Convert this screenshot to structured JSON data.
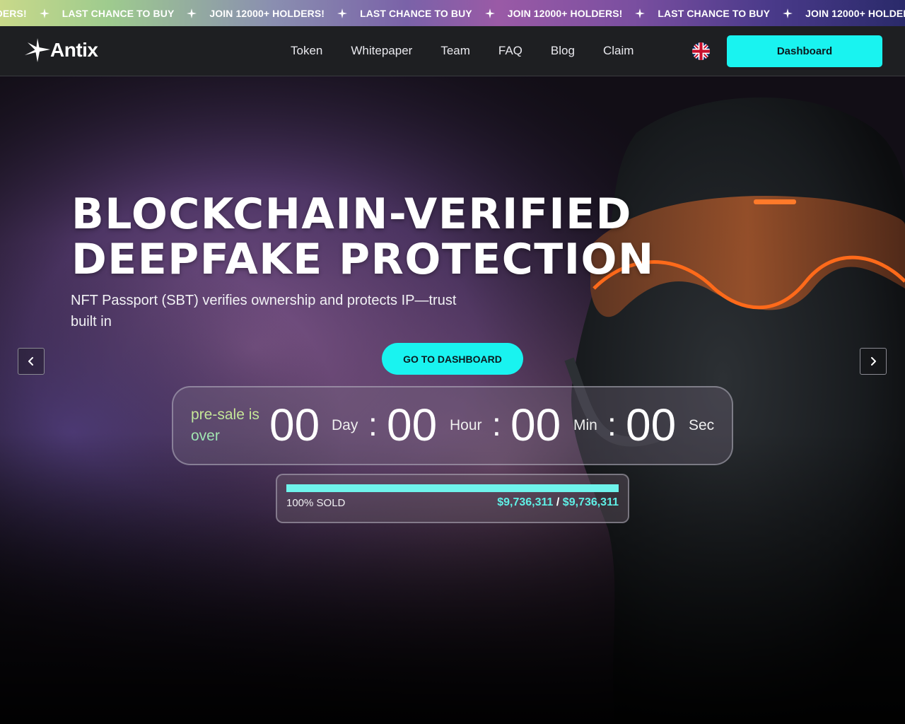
{
  "ticker": {
    "items": [
      "LDERS!",
      "LAST CHANCE TO BUY",
      "JOIN 12000+ HOLDERS!",
      "LAST CHANCE TO BUY",
      "JOIN 12000+ HOLDERS!",
      "LAST CHANCE TO BUY",
      "JOIN 12000+ HOLDERS!"
    ]
  },
  "header": {
    "logo_text": "Antix",
    "nav": [
      "Token",
      "Whitepaper",
      "Team",
      "FAQ",
      "Blog",
      "Claim"
    ],
    "language_icon": "uk-flag-icon",
    "dashboard_label": "Dashboard"
  },
  "hero": {
    "headline_line1": "BLOCKCHAIN-VERIFIED",
    "headline_line2": "DEEPFAKE PROTECTION",
    "subtitle": "NFT Passport (SBT) verifies ownership and protects IP—trust built in",
    "cta_label": "GO TO DASHBOARD",
    "prev_icon": "chevron-left-icon",
    "next_icon": "chevron-right-icon"
  },
  "countdown": {
    "status": "pre-sale is over",
    "days": "00",
    "day_label": "Day",
    "hours": "00",
    "hour_label": "Hour",
    "minutes": "00",
    "min_label": "Min",
    "seconds": "00",
    "sec_label": "Sec",
    "separator": ":"
  },
  "progress": {
    "percent": 100,
    "sold_label": "100% SOLD",
    "raised": "$9,736,311",
    "divider": "/",
    "goal": "$9,736,311"
  },
  "colors": {
    "accent": "#19f3f0",
    "header_bg": "#1e1f22",
    "progress_fill": "#6ff4ec"
  }
}
